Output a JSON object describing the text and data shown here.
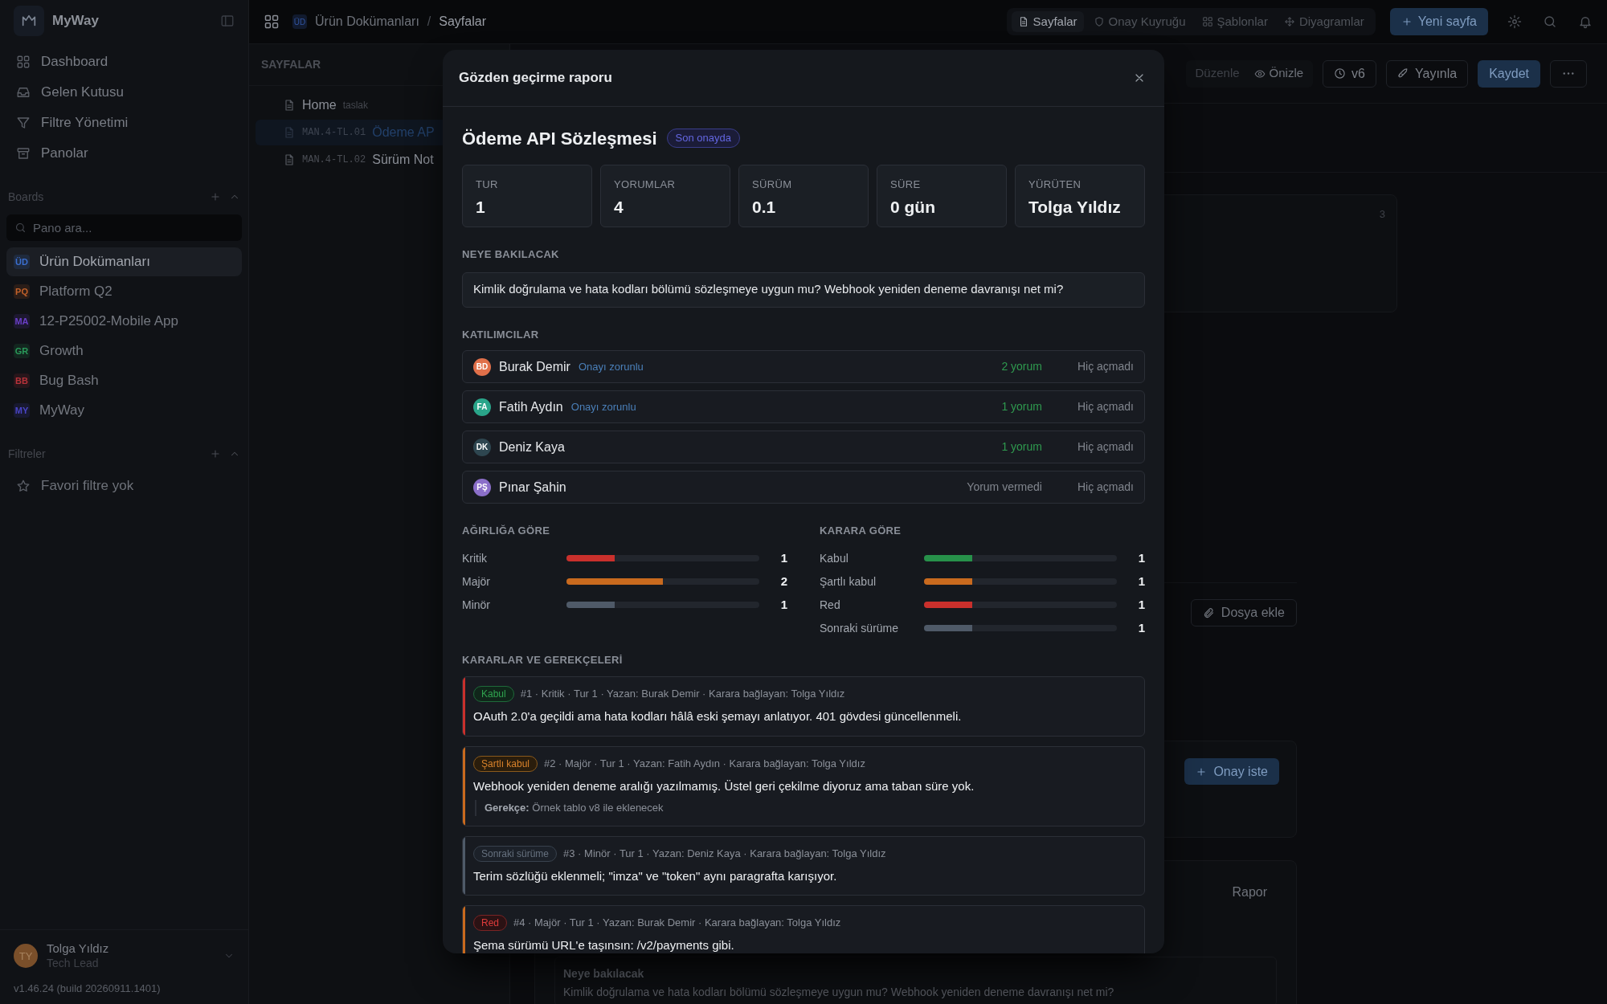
{
  "sidebar": {
    "app_name": "MyWay",
    "nav": [
      {
        "label": "Dashboard"
      },
      {
        "label": "Gelen Kutusu"
      },
      {
        "label": "Filtre Yönetimi"
      },
      {
        "label": "Panolar"
      }
    ],
    "boards_heading": "Boards",
    "board_search": {
      "placeholder": "Pano ara..."
    },
    "boards": [
      {
        "badge": "ÜD",
        "label": "Ürün Dokümanları",
        "color": "#3b6fd0",
        "selected": true
      },
      {
        "badge": "PQ",
        "label": "Platform Q2",
        "color": "#c2612a",
        "selected": false
      },
      {
        "badge": "MA",
        "label": "12-P25002-Mobile App",
        "color": "#6a3fc8",
        "selected": false
      },
      {
        "badge": "GR",
        "label": "Growth",
        "color": "#2a9a5a",
        "selected": false
      },
      {
        "badge": "BB",
        "label": "Bug Bash",
        "color": "#b8323a",
        "selected": false
      },
      {
        "badge": "MY",
        "label": "MyWay",
        "color": "#4a45c8",
        "selected": false
      }
    ],
    "filters_heading": "Filtreler",
    "filters_empty": "Favori filtre yok",
    "user": {
      "initials": "TY",
      "name": "Tolga Yıldız",
      "role": "Tech Lead"
    },
    "version": "v1.46.24 (build 20260911.1401)"
  },
  "breadcrumb": {
    "badge": "ÜD",
    "board": "Ürün Dokümanları",
    "separator": "/",
    "page": "Sayfalar"
  },
  "top_tabs": [
    {
      "label": "Sayfalar",
      "selected": true
    },
    {
      "label": "Onay Kuyruğu",
      "selected": false
    },
    {
      "label": "Şablonlar",
      "selected": false
    },
    {
      "label": "Diyagramlar",
      "selected": false
    }
  ],
  "new_page_button": "Yeni sayfa",
  "pages_panel": {
    "heading": "SAYFALAR",
    "pages": [
      {
        "title": "Home",
        "tag": "taslak",
        "selected": false
      },
      {
        "code": "MAN.4-TL.01",
        "title": "Ödeme AP",
        "selected": true
      },
      {
        "code": "MAN.4-TL.02",
        "title": "Sürüm Not",
        "selected": false
      }
    ]
  },
  "editor_toolbar": {
    "edit": "Düzenle",
    "preview": "Önizle",
    "version": "v6",
    "publish": "Yayınla",
    "save": "Kaydet"
  },
  "content": {
    "card_count": "3",
    "attach_button": "Dosya ekle",
    "approval_button": "Onay iste",
    "report_label": "Rapor",
    "review_heading": "Neye bakılacak",
    "review_question": "Kimlik doğrulama ve hata kodları bölümü sözleşmeye uygun mu? Webhook yeniden deneme davranışı net mi?"
  },
  "modal": {
    "title": "Gözden geçirme raporu",
    "doc_title": "Ödeme API Sözleşmesi",
    "status_badge": "Son onayda",
    "stats": [
      {
        "label": "TUR",
        "value": "1"
      },
      {
        "label": "YORUMLAR",
        "value": "4"
      },
      {
        "label": "SÜRÜM",
        "value": "0.1"
      },
      {
        "label": "SÜRE",
        "value": "0 gün"
      },
      {
        "label": "YÜRÜTEN",
        "value": "Tolga Yıldız"
      }
    ],
    "scope_heading": "NEYE BAKILACAK",
    "scope_text": "Kimlik doğrulama ve hata kodları bölümü sözleşmeye uygun mu? Webhook yeniden deneme davranışı net mi?",
    "participants_heading": "KATILIMCILAR",
    "participants": [
      {
        "initials": "BD",
        "name": "Burak Demir",
        "color": "#e0704a",
        "tag": "Onayı zorunlu",
        "comments": "2 yorum",
        "commented": true,
        "opened": "Hiç açmadı"
      },
      {
        "initials": "FA",
        "name": "Fatih Aydın",
        "color": "#2aa58a",
        "tag": "Onayı zorunlu",
        "comments": "1 yorum",
        "commented": true,
        "opened": "Hiç açmadı"
      },
      {
        "initials": "DK",
        "name": "Deniz Kaya",
        "color": "#2e4650",
        "comments": "1 yorum",
        "commented": true,
        "opened": "Hiç açmadı"
      },
      {
        "initials": "PŞ",
        "name": "Pınar Şahin",
        "color": "#8b6fc9",
        "comments": "Yorum vermedi",
        "commented": false,
        "opened": "Hiç açmadı"
      }
    ],
    "severity_heading": "AĞIRLIĞA GÖRE",
    "severity": [
      {
        "label": "Kritik",
        "level": 0.25,
        "count": "1",
        "color": "#c9302c"
      },
      {
        "label": "Majör",
        "level": 0.5,
        "count": "2",
        "color": "#c96a1e"
      },
      {
        "label": "Minör",
        "level": 0.25,
        "count": "1",
        "color": "#4f5a68"
      }
    ],
    "decision_heading": "KARARA GÖRE",
    "decisions": [
      {
        "label": "Kabul",
        "level": 0.25,
        "count": "1",
        "color": "#27914a"
      },
      {
        "label": "Şartlı kabul",
        "level": 0.25,
        "count": "1",
        "color": "#c96a1e"
      },
      {
        "label": "Red",
        "level": 0.25,
        "count": "1",
        "color": "#c9302c"
      },
      {
        "label": "Sonraki sürüme",
        "level": 0.25,
        "count": "1",
        "color": "#4f5a68"
      }
    ],
    "rationale_heading": "KARARLAR VE GEREKÇELERİ",
    "items": [
      {
        "kind": "accept",
        "badge": "Kabul",
        "color": "#c9302c",
        "meta": "#1 · Kritik · Tur 1 · Yazan: Burak Demir · Karara bağlayan: Tolga Yıldız",
        "text": "OAuth 2.0'a geçildi ama hata kodları hâlâ eski şemayı anlatıyor. 401 gövdesi güncellenmeli."
      },
      {
        "kind": "conditional",
        "badge": "Şartlı kabul",
        "color": "#c96a1e",
        "meta": "#2 · Majör · Tur 1 · Yazan: Fatih Aydın · Karara bağlayan: Tolga Yıldız",
        "text": "Webhook yeniden deneme aralığı yazılmamış. Üstel geri çekilme diyoruz ama taban süre yok.",
        "rationale": "**Gerekçe:** Örnek tablo v8 ile eklenecek"
      },
      {
        "kind": "next",
        "badge": "Sonraki sürüme",
        "color": "#4f5a68",
        "meta": "#3 · Minör · Tur 1 · Yazan: Deniz Kaya · Karara bağlayan: Tolga Yıldız",
        "text": "Terim sözlüğü eklenmeli; \"imza\" ve \"token\" aynı paragrafta karışıyor."
      },
      {
        "kind": "reject",
        "badge": "Red",
        "color": "#c96a1e",
        "meta": "#4 · Majör · Tur 1 · Yazan: Burak Demir · Karara bağlayan: Tolga Yıldız",
        "text": "Şema sürümü URL'e taşınsın: /v2/payments gibi."
      }
    ]
  }
}
